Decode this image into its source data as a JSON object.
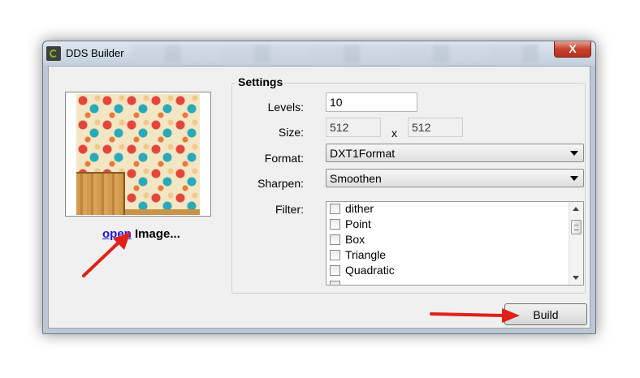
{
  "window": {
    "title": "DDS Builder",
    "close_glyph": "X"
  },
  "preview": {
    "open_link": "open",
    "open_suffix": "Image..."
  },
  "settings": {
    "group_title": "Settings",
    "levels_label": "Levels:",
    "levels_value": "10",
    "size_label": "Size:",
    "size_width": "512",
    "size_sep": "x",
    "size_height": "512",
    "format_label": "Format:",
    "format_value": "DXT1Format",
    "sharpen_label": "Sharpen:",
    "sharpen_value": "Smoothen",
    "filter_label": "Filter:",
    "filters": [
      "dither",
      "Point",
      "Box",
      "Triangle",
      "Quadratic"
    ]
  },
  "actions": {
    "build_label": "Build"
  },
  "colors": {
    "annotation_arrow": "#e0201a",
    "link": "#1a1ad6",
    "close": "#c7422e"
  },
  "icons": [
    "nvidia-app-icon",
    "close-icon",
    "chevron-down-icon",
    "scroll-up-icon",
    "scroll-down-icon",
    "red-arrow-annotation"
  ]
}
